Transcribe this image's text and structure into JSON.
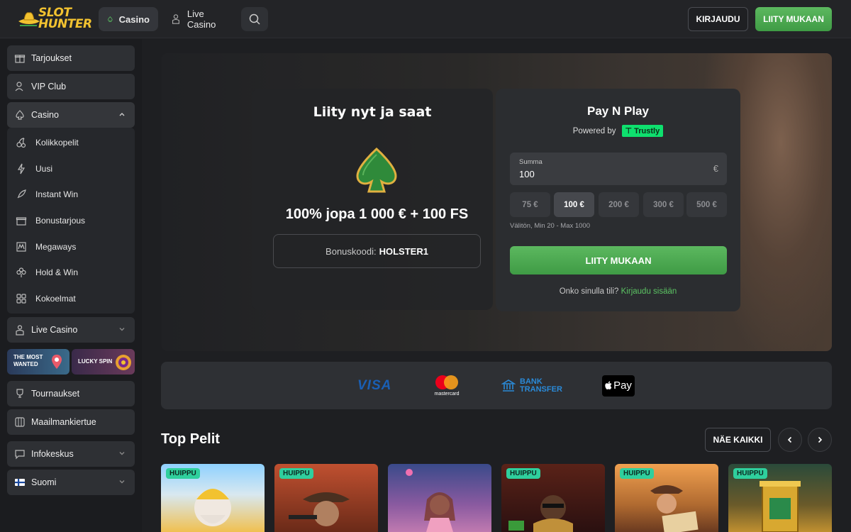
{
  "brand": {
    "logo_line1": "SLOT",
    "logo_line2": "HUNTER"
  },
  "topnav": {
    "casino": "Casino",
    "live_casino": "Live Casino",
    "login": "KIRJAUDU",
    "join": "LIITY MUKAAN"
  },
  "sidebar": {
    "items": [
      {
        "label": "Tarjoukset",
        "icon": "gift-icon"
      },
      {
        "label": "VIP Club",
        "icon": "user-icon"
      },
      {
        "label": "Casino",
        "icon": "spade-icon"
      }
    ],
    "casino_sub": [
      {
        "label": "Kolikkopelit",
        "icon": "cherry-icon"
      },
      {
        "label": "Uusi",
        "icon": "lightning-icon"
      },
      {
        "label": "Instant Win",
        "icon": "rocket-icon"
      },
      {
        "label": "Bonustarjous",
        "icon": "gift-icon"
      },
      {
        "label": "Megaways",
        "icon": "megaways-icon"
      },
      {
        "label": "Hold & Win",
        "icon": "clover-icon"
      },
      {
        "label": "Kokoelmat",
        "icon": "grid-icon"
      }
    ],
    "live_casino": "Live Casino",
    "promos": {
      "promo1": "THE MOST WANTED",
      "promo2": "LUCKY SPIN"
    },
    "tournaments": "Tournaukset",
    "world_tour": "Maailmankiertue",
    "info": "Infokeskus",
    "language": "Suomi"
  },
  "hero": {
    "title": "Liity nyt ja saat",
    "offer": "100% jopa 1 000 € + 100 FS",
    "bonus_label": "Bonuskoodi:",
    "bonus_code": "HOLSTER1"
  },
  "paynplay": {
    "title": "Pay N Play",
    "powered_by": "Powered by",
    "provider": "Trustly",
    "amount_label": "Summa",
    "amount_value": "100",
    "currency": "€",
    "quick_amounts": [
      "75 €",
      "100 €",
      "200 €",
      "300 €",
      "500 €"
    ],
    "selected_amount": "100 €",
    "hint": "Välitön, Min 20 - Max 1000",
    "join_button": "LIITY MUKAAN",
    "account_question": "Onko sinulla tili?",
    "login_link": "Kirjaudu sisään"
  },
  "payments": {
    "visa": "VISA",
    "mastercard": "mastercard",
    "bank_line1": "BANK",
    "bank_line2": "TRANSFER",
    "applepay": "Pay"
  },
  "top_games": {
    "title": "Top Pelit",
    "see_all": "NÄE KAIKKI",
    "badge": "HUIPPU",
    "cards": [
      {
        "badge": "HUIPPU",
        "color1": "#8fd1ff",
        "color2": "#f0c050"
      },
      {
        "badge": "HUIPPU",
        "color1": "#c05030",
        "color2": "#3a2418"
      },
      {
        "badge": "",
        "color1": "#3a4a8a",
        "color2": "#c07ab0"
      },
      {
        "badge": "HUIPPU",
        "color1": "#5a2218",
        "color2": "#2a1010"
      },
      {
        "badge": "HUIPPU",
        "color1": "#f0a050",
        "color2": "#6a3a20"
      },
      {
        "badge": "HUIPPU",
        "color1": "#2a4a3a",
        "color2": "#c09030"
      }
    ]
  },
  "colors": {
    "accent_green": "#4caf50",
    "trustly_green": "#0ee06e",
    "badge_teal": "#2fcf9d",
    "brand_yellow": "#f2c230"
  }
}
